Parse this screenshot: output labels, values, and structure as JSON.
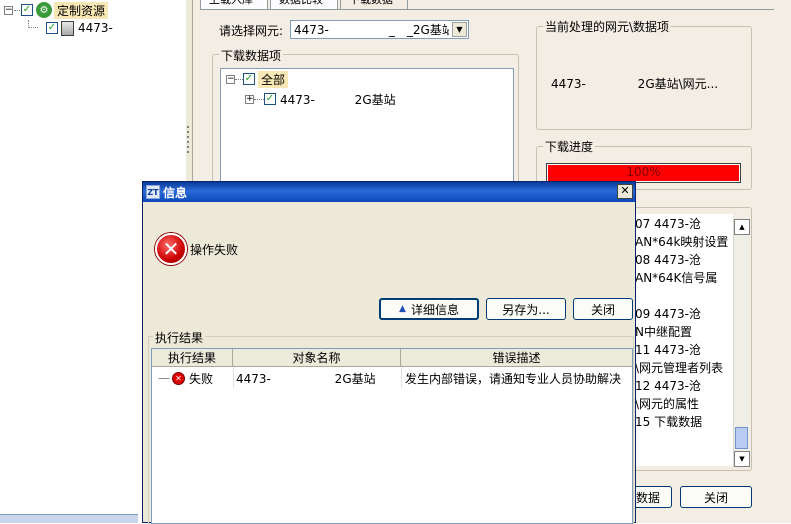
{
  "tree": {
    "root_label": "定制资源",
    "child_label": "4473-"
  },
  "tabs": [
    "上载入库",
    "数据比较",
    "下载数据"
  ],
  "main": {
    "select_ne_label": "请选择网元:",
    "select_ne_value": "4473-　　　　　_　_2G基站",
    "download_items_title": "下载数据项",
    "download_tree": {
      "root_label": "全部",
      "child_label": "4473-　　　 2G基站"
    },
    "current_item_title": "当前处理的网元\\数据项",
    "current_item_value": "4473-　　　　 2G基站\\网元...",
    "progress_title": "下载进度",
    "progress": {
      "percent": 100,
      "label": "100%",
      "color": "#ff0000"
    },
    "log_lines": [
      "07   4473-沧",
      "AN*64k映射设置",
      "08   4473-沧",
      "AN*64K信号属",
      "",
      "09   4473-沧",
      "N中继配置",
      "11   4473-沧",
      "\\网元管理者列表",
      "12   4473-沧",
      "\\网元的属性",
      "15  下载数据"
    ],
    "bottom_btn_partial": "数据",
    "close_btn": "关闭"
  },
  "dialog": {
    "title": "信息",
    "app_icon_text": "ZT",
    "message": "操作失败",
    "details_btn": "详细信息",
    "saveas_btn": "另存为...",
    "close_btn": "关闭",
    "results_title": "执行结果",
    "columns": [
      "执行结果",
      "对象名称",
      "错误描述"
    ],
    "rows": [
      {
        "status": "失败",
        "object": "4473-　　　　　 2G基站",
        "error": "发生内部错误，请通知专业人员协助解决"
      }
    ]
  },
  "colors": {
    "accent_title": "#0a3a9a",
    "error_red": "#cc0000",
    "panel_bg": "#f3ede3"
  }
}
